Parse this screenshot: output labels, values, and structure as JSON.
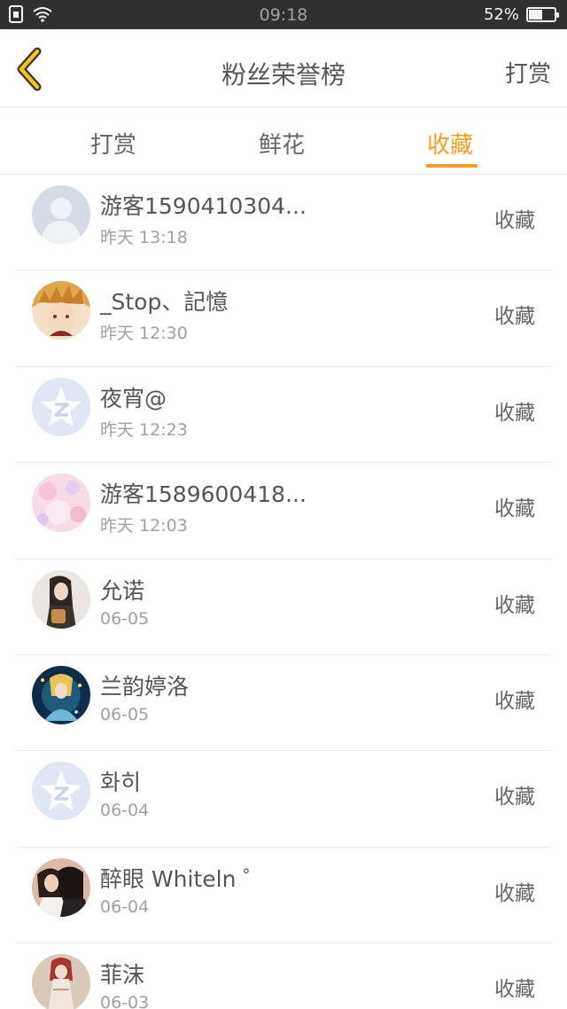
{
  "status_bar": {
    "time": "09:18",
    "battery": "52%",
    "battery_level": 0.52
  },
  "header": {
    "title": "粉丝荣誉榜",
    "action_label": "打赏"
  },
  "tabs": [
    {
      "label": "打赏",
      "active": false
    },
    {
      "label": "鲜花",
      "active": false
    },
    {
      "label": "收藏",
      "active": true
    }
  ],
  "colors": {
    "accent": "#f29f1a",
    "status_bar": "#303030",
    "divider": "#e9e9e9"
  },
  "fans": [
    {
      "name": "游客1590410304...",
      "time": "昨天 13:18",
      "tag": "收藏",
      "avatar": "default-person-avatar"
    },
    {
      "name": "_Stop、記憶",
      "time": "昨天 12:30",
      "tag": "收藏",
      "avatar": "anime-boy-avatar"
    },
    {
      "name": "夜宵@",
      "time": "昨天 12:23",
      "tag": "收藏",
      "avatar": "qq-zone-star-avatar"
    },
    {
      "name": "游客1589600418...",
      "time": "昨天 12:03",
      "tag": "收藏",
      "avatar": "pink-floral-avatar"
    },
    {
      "name": "允诺",
      "time": "06-05",
      "tag": "收藏",
      "avatar": "girl-photo-avatar"
    },
    {
      "name": "兰韵婷洛",
      "time": "06-05",
      "tag": "收藏",
      "avatar": "fantasy-art-avatar"
    },
    {
      "name": "화히",
      "time": "06-04",
      "tag": "收藏",
      "avatar": "qq-zone-star-avatar"
    },
    {
      "name": "醉眼 Whiteln ゜",
      "time": "06-04",
      "tag": "收藏",
      "avatar": "couple-photo-avatar"
    },
    {
      "name": "菲沫",
      "time": "06-03",
      "tag": "收藏",
      "avatar": "red-hair-anime-avatar"
    }
  ]
}
